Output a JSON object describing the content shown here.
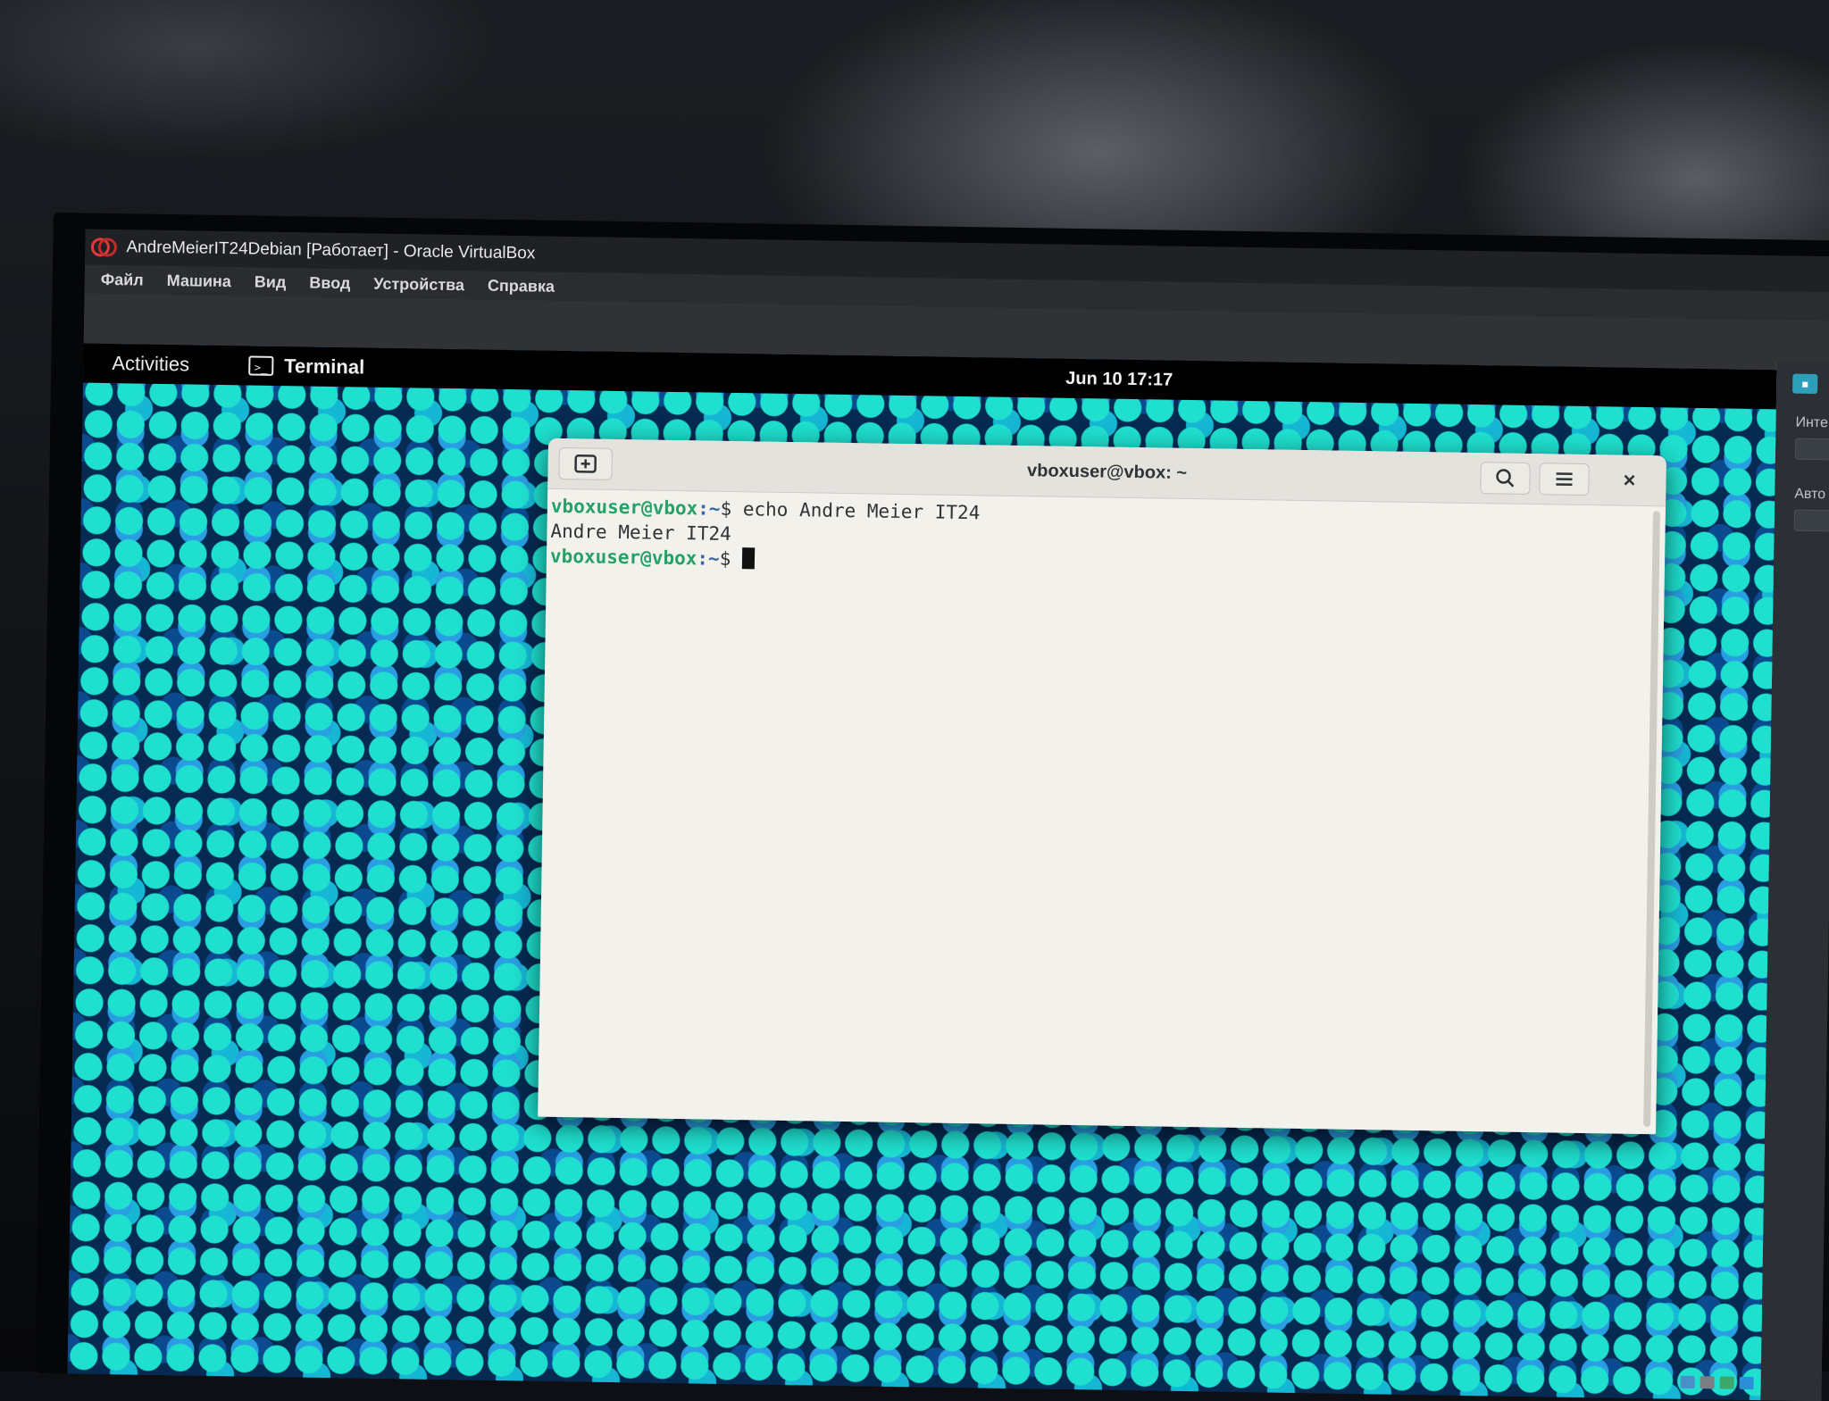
{
  "vbox": {
    "title": "AndreMeierIT24Debian [Работает] - Oracle VirtualBox",
    "menu": [
      "Файл",
      "Машина",
      "Вид",
      "Ввод",
      "Устройства",
      "Справка"
    ],
    "sidepanel": {
      "label_1": "Инте",
      "label_2": "Авто"
    }
  },
  "gnome": {
    "activities": "Activities",
    "app_name": "Terminal",
    "app_icon_glyph": ">_",
    "clock": "Jun 10  17:17"
  },
  "terminal": {
    "title": "vboxuser@vbox: ~",
    "lines": [
      {
        "user_host": "vboxuser@vbox",
        "path": ":~",
        "symbol": "$",
        "command": " echo Andre Meier IT24"
      },
      {
        "output": "Andre Meier IT24"
      },
      {
        "user_host": "vboxuser@vbox",
        "path": ":~",
        "symbol": "$",
        "command": " "
      }
    ]
  },
  "icons": {
    "vbox_logo": "virtualbox-logo-icon",
    "new_tab": "new-tab-icon",
    "search": "search-icon",
    "menu": "hamburger-menu-icon",
    "close": "close-icon",
    "terminal_app": "terminal-icon"
  },
  "colors": {
    "prompt_user": "#26a269",
    "prompt_path": "#3465a4",
    "terminal_bg": "#f3f1ec",
    "topbar_bg": "#000000"
  }
}
